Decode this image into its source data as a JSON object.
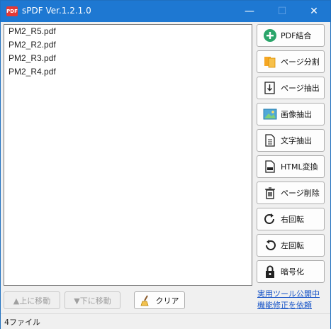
{
  "window": {
    "title": "sPDF Ver.1.2.1.0",
    "app_icon_text": "PDF",
    "controls": {
      "minimize": "—",
      "maximize": "☐",
      "close": "✕"
    }
  },
  "file_list": [
    "PM2_R5.pdf",
    "PM2_R2.pdf",
    "PM2_R3.pdf",
    "PM2_R4.pdf"
  ],
  "side_buttons": [
    {
      "label": "PDF結合",
      "icon": "plus-circle-icon"
    },
    {
      "label": "ページ分割",
      "icon": "split-pages-icon"
    },
    {
      "label": "ページ抽出",
      "icon": "page-extract-icon"
    },
    {
      "label": "画像抽出",
      "icon": "image-icon"
    },
    {
      "label": "文字抽出",
      "icon": "document-text-icon"
    },
    {
      "label": "HTML変換",
      "icon": "html-file-icon"
    },
    {
      "label": "ページ削除",
      "icon": "trash-icon"
    },
    {
      "label": "右回転",
      "icon": "rotate-right-icon"
    },
    {
      "label": "左回転",
      "icon": "rotate-left-icon"
    },
    {
      "label": "暗号化",
      "icon": "lock-icon"
    }
  ],
  "bottom": {
    "move_up": "▲上に移動",
    "move_down": "▼下に移動",
    "clear": "クリア"
  },
  "links": {
    "tools": "実用ツール公開中",
    "request": "機能修正を依頼"
  },
  "status": {
    "file_count": "4ファイル"
  },
  "colors": {
    "titlebar": "#1e78d2",
    "accent_green": "#2aa56a",
    "link": "#1a56c8"
  }
}
